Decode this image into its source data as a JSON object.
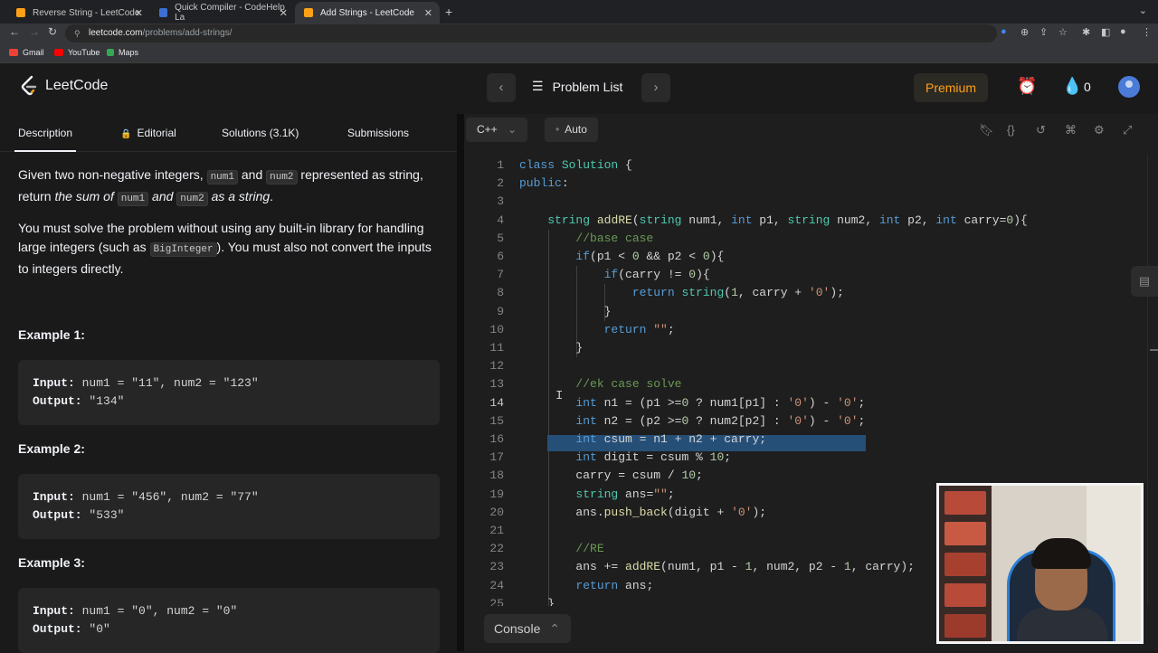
{
  "browser": {
    "tabs": [
      {
        "title": "Reverse String - LeetCode",
        "active": false
      },
      {
        "title": "Quick Compiler - CodeHelp La",
        "active": false
      },
      {
        "title": "Add Strings - LeetCode",
        "active": true
      }
    ],
    "url_host": "leetcode.com",
    "url_path": "/problems/add-strings/",
    "bookmarks": [
      "Gmail",
      "YouTube",
      "Maps"
    ]
  },
  "header": {
    "logo_text": "LeetCode",
    "problem_list_label": "Problem List",
    "premium_label": "Premium",
    "streak_count": "0"
  },
  "left_tabs": [
    "Description",
    "Editorial",
    "Solutions (3.1K)",
    "Submissions"
  ],
  "description": {
    "p1_a": "Given two non-negative integers, ",
    "p1_code1": "num1",
    "p1_b": " and ",
    "p1_code2": "num2",
    "p1_c": " represented as string, return ",
    "p1_em1": "the sum of ",
    "p1_code3": "num1",
    "p1_em2": " and ",
    "p1_code4": "num2",
    "p1_em3": " as a string",
    "p1_d": ".",
    "p2_a": "You must solve the problem without using any built-in library for handling large integers (such as ",
    "p2_code": "BigInteger",
    "p2_b": "). You must also not convert the inputs to integers directly."
  },
  "examples": [
    {
      "heading": "Example 1:",
      "input_label": "Input:",
      "input": " num1 = \"11\", num2 = \"123\"",
      "output_label": "Output:",
      "output": " \"134\""
    },
    {
      "heading": "Example 2:",
      "input_label": "Input:",
      "input": " num1 = \"456\", num2 = \"77\"",
      "output_label": "Output:",
      "output": " \"533\""
    },
    {
      "heading": "Example 3:",
      "input_label": "Input:",
      "input": " num1 = \"0\", num2 = \"0\"",
      "output_label": "Output:",
      "output": " \"0\""
    }
  ],
  "editor": {
    "language": "C++",
    "mode": "Auto",
    "console_label": "Console",
    "current_line": 14,
    "line_numbers": [
      "1",
      "2",
      "3",
      "4",
      "5",
      "6",
      "7",
      "8",
      "9",
      "10",
      "11",
      "12",
      "13",
      "14",
      "15",
      "16",
      "17",
      "18",
      "19",
      "20",
      "21",
      "22",
      "23",
      "24",
      "25"
    ],
    "code": [
      "class Solution {",
      "public:",
      "",
      "    string addRE(string num1, int p1, string num2, int p2, int carry=0){",
      "        //base case",
      "        if(p1 < 0 && p2 < 0){",
      "            if(carry != 0){",
      "                return string(1, carry + '0');",
      "            }",
      "            return \"\";",
      "        }",
      "",
      "        //ek case solve",
      "        int n1 = (p1 >=0 ? num1[p1] : '0') - '0';",
      "        int n2 = (p2 >=0 ? num2[p2] : '0') - '0';",
      "        int csum = n1 + n2 + carry;",
      "        int digit = csum % 10;",
      "        carry = csum / 10;",
      "        string ans=\"\";",
      "        ans.push_back(digit + '0');",
      "",
      "        //RE",
      "        ans += addRE(num1, p1 - 1, num2, p2 - 1, carry);",
      "        return ans;",
      "    }"
    ]
  },
  "colors": {
    "accent": "#ffa116",
    "background": "#1a1a1a",
    "editor_bg": "#1e1e1e",
    "selection": "#264f78"
  }
}
